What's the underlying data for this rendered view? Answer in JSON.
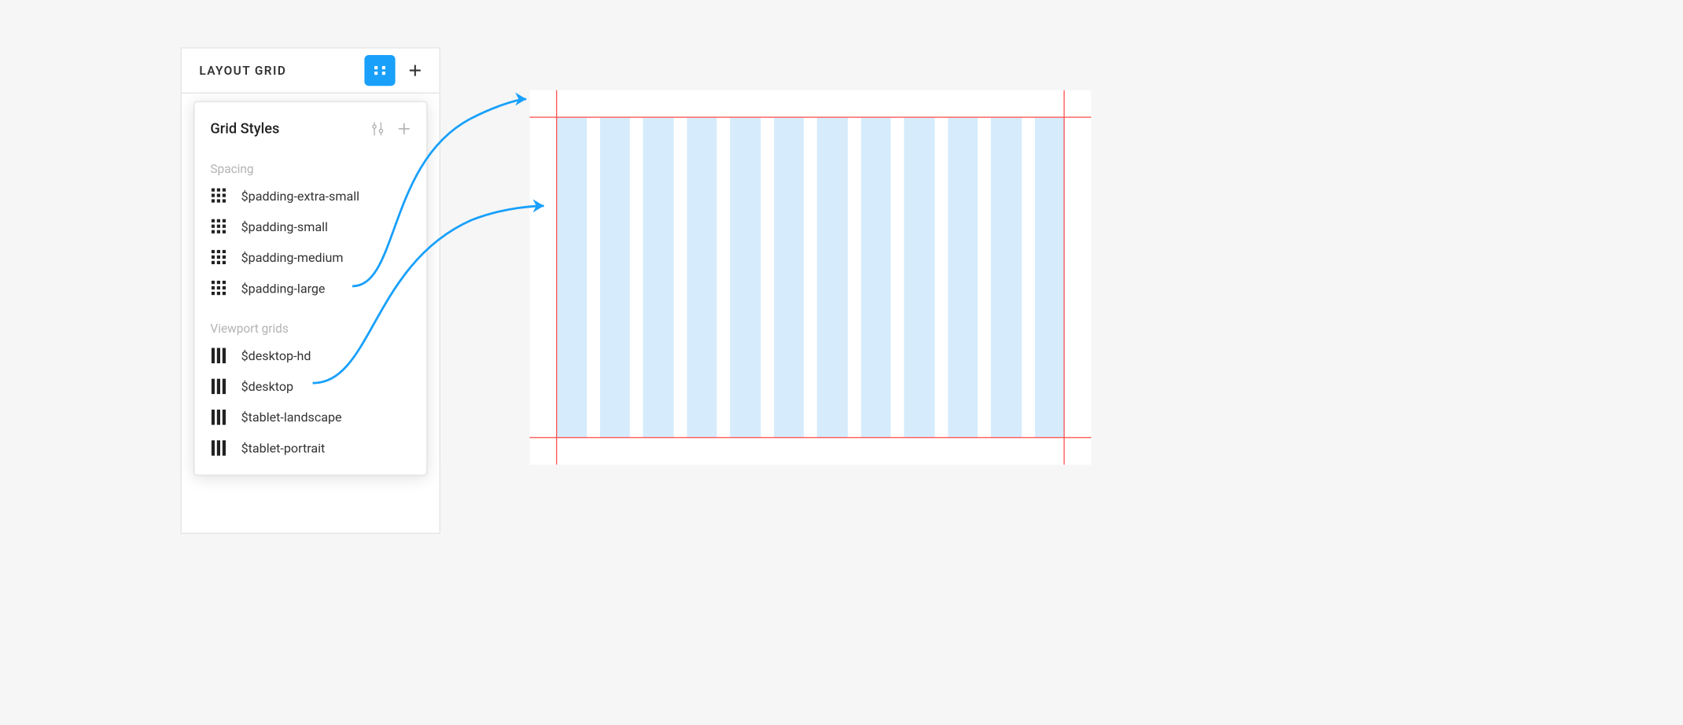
{
  "panel": {
    "title": "LAYOUT GRID"
  },
  "popover": {
    "title": "Grid Styles",
    "groups": {
      "spacing": {
        "label": "Spacing",
        "items": [
          "$padding-extra-small",
          "$padding-small",
          "$padding-medium",
          "$padding-large"
        ]
      },
      "viewport": {
        "label": "Viewport grids",
        "items": [
          "$desktop-hd",
          "$desktop",
          "$tablet-landscape",
          "$tablet-portrait"
        ]
      }
    }
  },
  "canvas": {
    "columns": 12
  },
  "colors": {
    "accent": "#18a0fb",
    "column": "#d6ecfc",
    "guide": "#ff5b5b"
  }
}
